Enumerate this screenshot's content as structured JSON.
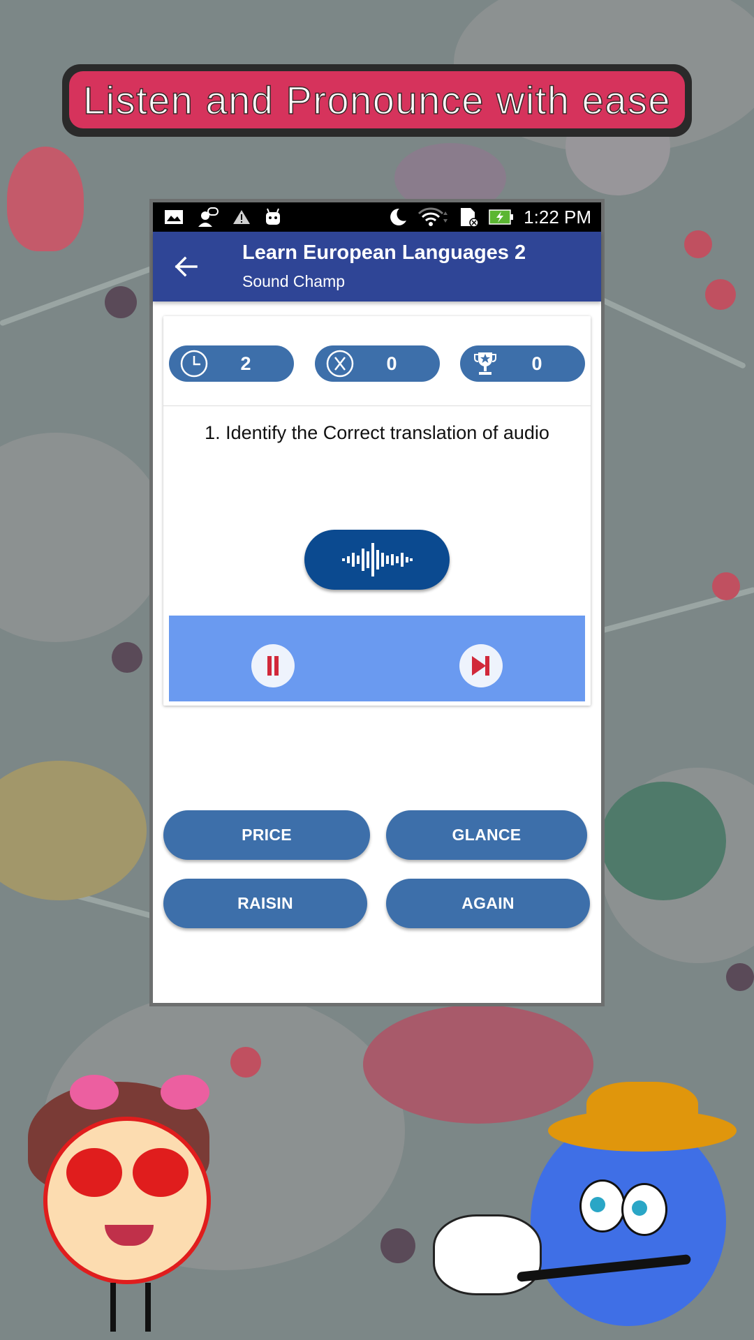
{
  "promo_banner": {
    "text": "Listen and Pronounce with ease"
  },
  "status_bar": {
    "left_icons": [
      "image-icon",
      "chat-user-icon",
      "warning-icon",
      "android-icon"
    ],
    "right_icons": [
      "do-not-disturb-moon-icon",
      "wifi-icon",
      "sd-card-error-icon",
      "battery-charging-icon"
    ],
    "time": "1:22 PM",
    "battery_color": "#5bb632"
  },
  "app_bar": {
    "title": "Learn European Languages 2",
    "subtitle": "Sound Champ",
    "background": "#2f4596"
  },
  "stats": [
    {
      "icon": "clock-icon",
      "value": "2"
    },
    {
      "icon": "wrong-x-icon",
      "value": "0"
    },
    {
      "icon": "trophy-icon",
      "value": "0"
    }
  ],
  "quiz": {
    "question": "1. Identify the Correct translation of  audio",
    "audio_button_icon": "sound-wave-icon"
  },
  "player": {
    "pause_icon": "pause-icon",
    "next_icon": "skip-next-icon",
    "accent": "#d1283a"
  },
  "answers": [
    {
      "label": "PRICE"
    },
    {
      "label": "GLANCE"
    },
    {
      "label": "RAISIN"
    },
    {
      "label": "AGAIN"
    }
  ],
  "colors": {
    "button_blue": "#3d6faa",
    "audio_blue": "#0b4a90",
    "player_band": "#6a9af0",
    "banner_red": "#d6335c"
  }
}
